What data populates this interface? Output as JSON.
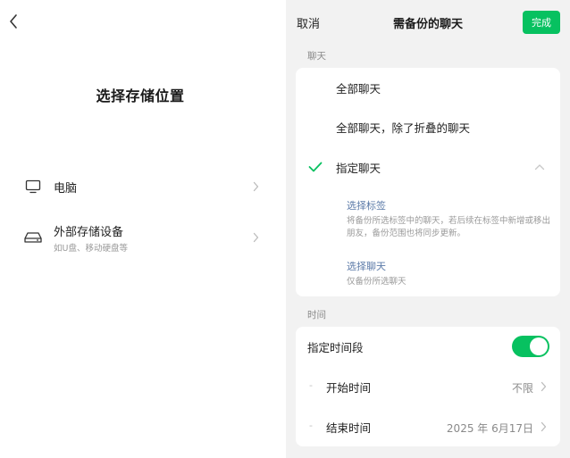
{
  "left": {
    "title": "选择存储位置",
    "options": [
      {
        "name": "电脑",
        "icon": "monitor-icon"
      },
      {
        "name": "外部存储设备",
        "sub": "如U盘、移动硬盘等",
        "icon": "hard-drive-icon"
      }
    ]
  },
  "right": {
    "header": {
      "cancel": "取消",
      "title": "需备份的聊天",
      "done": "完成"
    },
    "chat_section": {
      "label": "聊天",
      "options": [
        {
          "label": "全部聊天",
          "selected": false
        },
        {
          "label": "全部聊天，除了折叠的聊天",
          "selected": false
        },
        {
          "label": "指定聊天",
          "selected": true,
          "expanded": true
        }
      ],
      "sub_options": [
        {
          "title": "选择标签",
          "desc": "将备份所选标签中的聊天，若后续在标签中新增或移出朋友，备份范围也将同步更新。"
        },
        {
          "title": "选择聊天",
          "desc": "仅备份所选聊天"
        }
      ]
    },
    "time_section": {
      "label": "时间",
      "toggle_label": "指定时间段",
      "toggle_on": true,
      "start_label": "开始时间",
      "start_value": "不限",
      "end_label": "结束时间",
      "end_value": "2025 年 6月17日"
    }
  },
  "colors": {
    "accent": "#07c160",
    "link_blue": "#5b7aa8",
    "panel_bg": "#f2f2f2"
  }
}
